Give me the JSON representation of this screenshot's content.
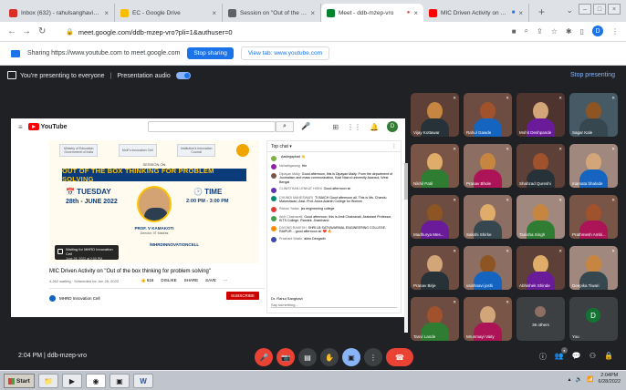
{
  "browser": {
    "tabs": [
      {
        "title": "Inbox (632) - rahulsanghavi@sri",
        "fav": "#d93025"
      },
      {
        "title": "EC - Google Drive",
        "fav": "#fbbc04"
      },
      {
        "title": "Session on \"Out of the box think",
        "fav": "#5f6368"
      },
      {
        "title": "Meet - ddb-mzep-vro",
        "fav": "#00832d"
      },
      {
        "title": "MIC Driven Activity on \"Out",
        "fav": "#ff0000"
      }
    ],
    "new_tab": "+",
    "url": "meet.google.com/ddb-mzep-vro?pli=1&authuser=0"
  },
  "infobar": {
    "text": "Sharing https://www.youtube.com to meet.google.com",
    "stop_label": "Stop sharing",
    "view_label": "View tab: www.youtube.com"
  },
  "meet": {
    "presenting_text": "You're presenting to everyone",
    "audio_label": "Presentation audio",
    "stop_presenting": "Stop presenting",
    "time": "2:04 PM",
    "meeting_code": "ddb-mzep-vro",
    "participants": [
      {
        "name": "Vijay Kottawar",
        "bg": "#5d4037"
      },
      {
        "name": "Rahul Gawde",
        "bg": "#6d4c41"
      },
      {
        "name": "Mohit Deshpande",
        "bg": "#4e342e"
      },
      {
        "name": "Sagar Kale",
        "bg": "#455a64"
      },
      {
        "name": "Nikhil Patil",
        "bg": "#795548"
      },
      {
        "name": "Pranav Bhole",
        "bg": "#8d6e63"
      },
      {
        "name": "Shahzad Qureshi",
        "bg": "#5d4037"
      },
      {
        "name": "mamata bhalode",
        "bg": "#a1887f"
      },
      {
        "name": "Madhurya Mes...",
        "bg": "#6d4c41"
      },
      {
        "name": "Sakshi Shirke",
        "bg": "#8d6e63"
      },
      {
        "name": "Tanisha Singh",
        "bg": "#a1887f"
      },
      {
        "name": "Prathmesh Ambi...",
        "bg": "#795548"
      },
      {
        "name": "Pranav Birje",
        "bg": "#6d4c41"
      },
      {
        "name": "vaishnavi joshi",
        "bg": "#8d6e63"
      },
      {
        "name": "Abhishek Shinde",
        "bg": "#5d4037"
      },
      {
        "name": "Deepika Tiwari",
        "bg": "#a1887f"
      },
      {
        "name": "Tanvi Lande",
        "bg": "#6d4c41"
      },
      {
        "name": "Mrunmayi Vaity",
        "bg": "#795548"
      }
    ],
    "others_label": "36 others",
    "you_label": "You",
    "you_initial": "D"
  },
  "youtube": {
    "logo": "YouTube",
    "title": "MIC Driven Activity on \"Out of the box thinking for problem solving\"",
    "meta": "4,262 waiting · Scheduled for Jun 28, 2022",
    "actions": [
      "👍 616",
      "DISLIKE",
      "SHARE",
      "SAVE",
      "···"
    ],
    "channel": "MHRD Innovation Cell",
    "subscribe": "SUBSCRIBE",
    "video": {
      "logos": [
        "Ministry of Education Government of India",
        "MoE's Innovation Cell",
        "Institution's Innovation Council"
      ],
      "session_on": "SESSION ON",
      "banner": "OUT OF THE BOX THINKING FOR PROBLEM SOLVING",
      "day": "📅 TUESDAY",
      "date": "28th - JUNE 2022",
      "time_label": "🕑 TIME",
      "time_range": "2:00 PM - 3:00 PM",
      "speaker": "PROF. V KAMAKOTI",
      "speaker_sub": "Director, IIT Madras",
      "handle": "/MHRDINNOVATIONCELL",
      "waiting": "Waiting for MHRD Innovation Cell",
      "waiting_date": "June 28, 2022 at 2:00 PM"
    },
    "chat": {
      "header": "Top chat ▾",
      "messages": [
        {
          "author": "",
          "text": "Aaslegapbad 👋",
          "color": "#7cb342"
        },
        {
          "author": "Nehathgarang",
          "text": "Hie",
          "color": "#8e24aa"
        },
        {
          "author": "Dipayan Maity",
          "text": "Good afternoon, this is Dipayan Maity. From the department of Journalism and mass communication, Kazi Nazrul university Asansol, West Bengal",
          "color": "#795548"
        },
        {
          "author": "CLINISTHAN LENKAT HISHI",
          "text": "Good afternoon sir",
          "color": "#5e35b1"
        },
        {
          "author": "CHUNDI MAHESWARI",
          "text": "TI BAICH Good afternoon all. This is Ms. Chandu Maheshwari, Asst. Prof. Arora Adarsh College for Women",
          "color": "#00897b"
        },
        {
          "author": "Rishav Yadav",
          "text": "jss engineering college",
          "color": "#e53935"
        },
        {
          "author": "Amit Chakravati",
          "text": "Good afternoon, this is Amit Chakravati, Assistant Professor, KITS College, Ramtek, Jharkhand",
          "color": "#43a047"
        },
        {
          "author": "DIVONS RAKESH",
          "text": "SHRI LB SATYAVARMAL ENGINEERING COLLEGE, RAIPUR... good afternoon sir ❤️ 🔥",
          "color": "#fb8c00"
        },
        {
          "author": "Prashant Wakle",
          "text": "akhu Deogadh",
          "color": "#3949ab"
        }
      ],
      "input_name": "Dr. Rahul Sanghavi",
      "input_placeholder": "Say something..."
    }
  },
  "taskbar": {
    "start": "Start",
    "time": "2:04PM",
    "date": "6/28/2022"
  }
}
